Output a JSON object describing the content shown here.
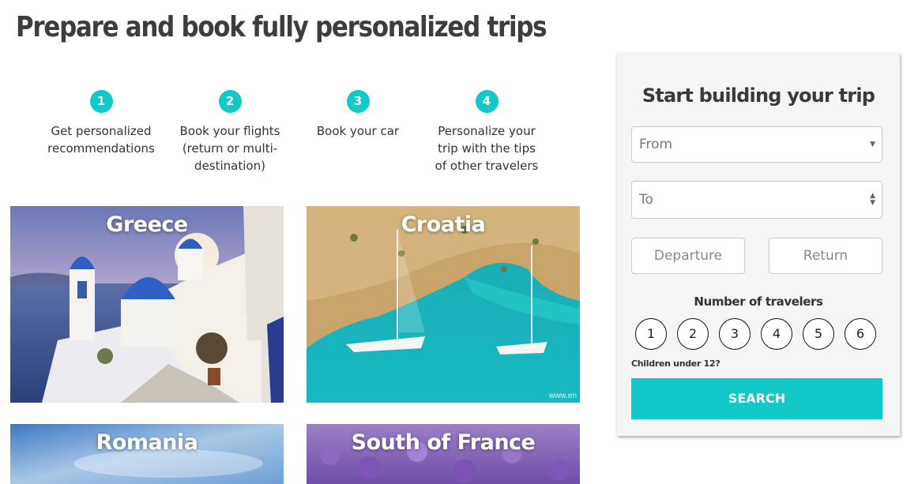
{
  "page": {
    "title": "Prepare and book fully personalized trips"
  },
  "steps": [
    {
      "num": "1",
      "text": "Get personalized recommendations"
    },
    {
      "num": "2",
      "text": "Book your flights (return or multi-destination)"
    },
    {
      "num": "3",
      "text": "Book your car"
    },
    {
      "num": "4",
      "text": "Personalize your trip with the tips of other travelers"
    }
  ],
  "destinations": [
    {
      "name": "Greece"
    },
    {
      "name": "Croatia",
      "watermark": "www.en"
    },
    {
      "name": "Romania"
    },
    {
      "name": "South of France"
    }
  ],
  "form": {
    "title": "Start building your trip",
    "from_placeholder": "From",
    "to_placeholder": "To",
    "departure_label": "Departure",
    "return_label": "Return",
    "travelers_label": "Number of travelers",
    "traveler_options": [
      "1",
      "2",
      "3",
      "4",
      "5",
      "6"
    ],
    "children_label": "Children under 12?",
    "search_label": "SEARCH"
  },
  "colors": {
    "accent": "#12c8c8"
  },
  "icons": {
    "select_arrow": "caret-down-icon",
    "stepper": "up-down-arrows-icon"
  }
}
